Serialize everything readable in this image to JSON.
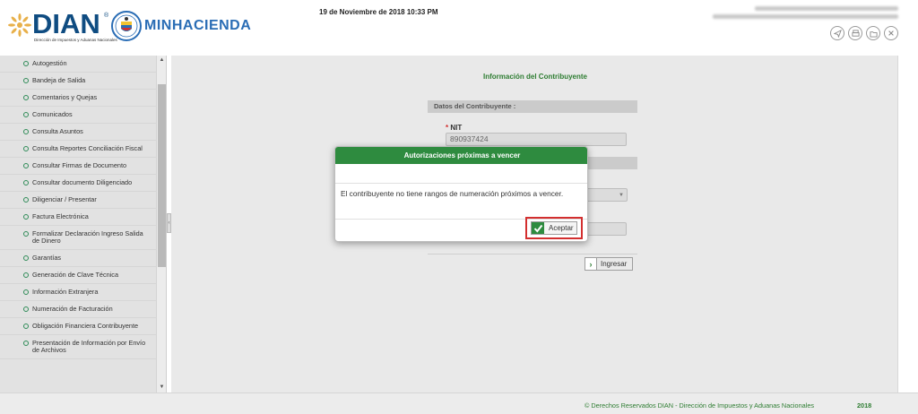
{
  "header": {
    "logo_dian": {
      "word": "DIAN",
      "registered": "®",
      "subtitle": "Dirección de Impuestos y Aduanas Nacionales"
    },
    "logo_min": {
      "word": "MINHACIENDA"
    },
    "datetime": "19 de Noviembre de 2018 10:33 PM",
    "icons": [
      "send-icon",
      "print-icon",
      "folder-icon",
      "close-icon"
    ]
  },
  "sidebar": {
    "items": [
      {
        "label": "Autogestión"
      },
      {
        "label": "Bandeja de Salida"
      },
      {
        "label": "Comentarios y Quejas"
      },
      {
        "label": "Comunicados"
      },
      {
        "label": "Consulta Asuntos"
      },
      {
        "label": "Consulta Reportes Conciliación Fiscal"
      },
      {
        "label": "Consultar Firmas de Documento"
      },
      {
        "label": "Consultar documento Diligenciado"
      },
      {
        "label": "Diligenciar / Presentar"
      },
      {
        "label": "Factura Electrónica"
      },
      {
        "label": "Formalizar Declaración Ingreso Salida de Dinero"
      },
      {
        "label": "Garantías"
      },
      {
        "label": "Generación de Clave Técnica"
      },
      {
        "label": "Información Extranjera"
      },
      {
        "label": "Numeración de Facturación"
      },
      {
        "label": "Obligación Financiera Contribuyente"
      },
      {
        "label": "Presentación de Información por Envío de Archivos"
      }
    ]
  },
  "main": {
    "title": "Información del Contribuyente",
    "section_label": "Datos del Contribuyente :",
    "nit_required": "*",
    "nit_label": "NIT",
    "nit_value": "890937424",
    "ingresar_label": "Ingresar"
  },
  "modal": {
    "title": "Autorizaciones próximas a vencer",
    "message": "El contribuyente no tiene rangos de numeración próximos a vencer.",
    "accept_label": "Aceptar"
  },
  "footer": {
    "copyright": "© Derechos Reservados DIAN - Dirección de Impuestos y Aduanas Nacionales",
    "year": "2018"
  },
  "colors": {
    "brand_green": "#2e8b3f",
    "brand_blue": "#0f4c81",
    "highlight_red": "#d32f2f"
  }
}
